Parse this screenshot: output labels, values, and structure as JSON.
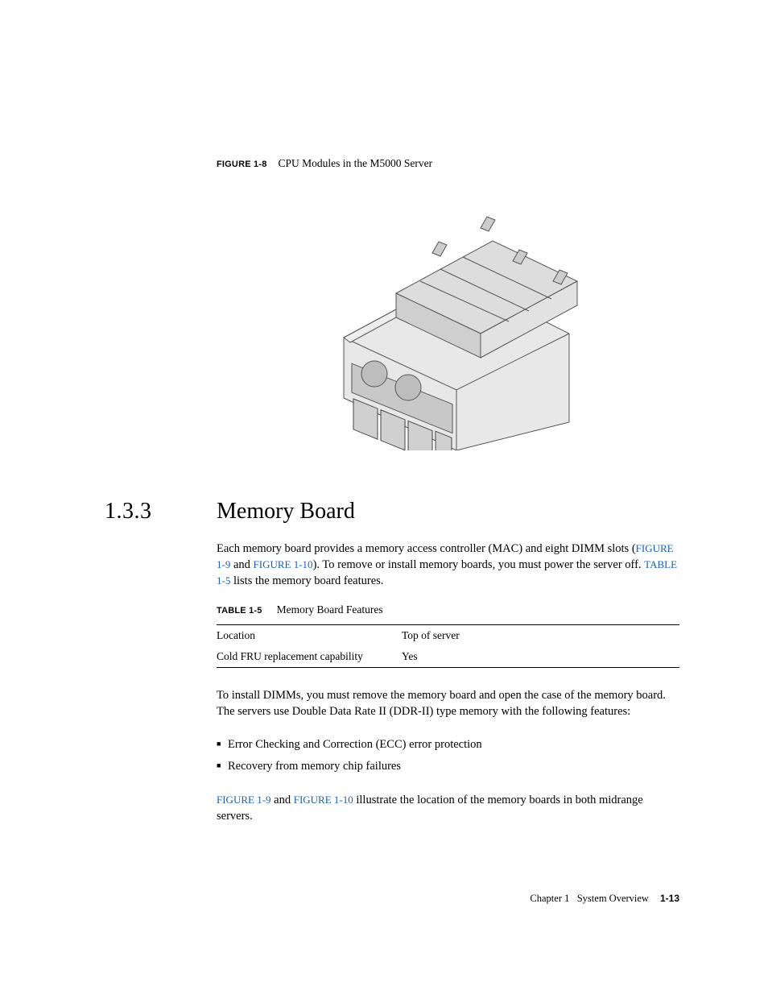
{
  "figure": {
    "label": "FIGURE 1-8",
    "caption": "CPU Modules in the M5000 Server"
  },
  "section": {
    "number": "1.3.3",
    "title": "Memory Board"
  },
  "para1_a": "Each memory board provides a memory access controller (MAC) and eight DIMM slots (",
  "link_fig19_a": "FIGURE 1-9",
  "para1_and": " and ",
  "link_fig110_a": "FIGURE 1-10",
  "para1_b": "). To remove or install memory boards, you must power the server off. ",
  "link_table15": "TABLE 1-5",
  "para1_c": " lists the memory board features.",
  "table": {
    "label": "TABLE 1-5",
    "caption": "Memory Board Features",
    "rows": [
      {
        "k": "Location",
        "v": "Top of server"
      },
      {
        "k": "Cold FRU replacement capability",
        "v": "Yes"
      }
    ]
  },
  "para2": "To install DIMMs, you must remove the memory board and open the case of the memory board. The servers use Double Data Rate II (DDR-II) type memory with the following features:",
  "bullets": [
    "Error Checking and Correction (ECC) error protection",
    "Recovery from memory chip failures"
  ],
  "link_fig19_b": "FIGURE 1-9",
  "para3_and": " and ",
  "link_fig110_b": "FIGURE 1-10",
  "para3_rest": " illustrate the location of the memory boards in both midrange servers.",
  "footer": {
    "chapter": "Chapter 1",
    "chapter_title": "System Overview",
    "page": "1-13"
  }
}
